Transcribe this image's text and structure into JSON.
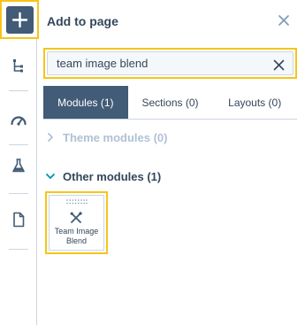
{
  "panel": {
    "title": "Add to page"
  },
  "search": {
    "value": "team image blend",
    "placeholder": ""
  },
  "tabs": [
    {
      "label": "Modules (1)",
      "active": true
    },
    {
      "label": "Sections (0)",
      "active": false
    },
    {
      "label": "Layouts (0)",
      "active": false
    }
  ],
  "groups": {
    "theme": {
      "label": "Theme modules (0)"
    },
    "other": {
      "label": "Other modules (1)"
    }
  },
  "module_card": {
    "label": "Team Image Blend",
    "icon": "wrench-screwdriver-icon"
  },
  "rail_icons": [
    "add-icon",
    "tree-structure-icon",
    "gauge-icon",
    "flask-icon",
    "document-icon"
  ],
  "colors": {
    "accent": "#425b76",
    "highlight": "#f5c518",
    "text": "#33475b",
    "muted": "#b0c1d4",
    "border": "#cbd6e2"
  }
}
